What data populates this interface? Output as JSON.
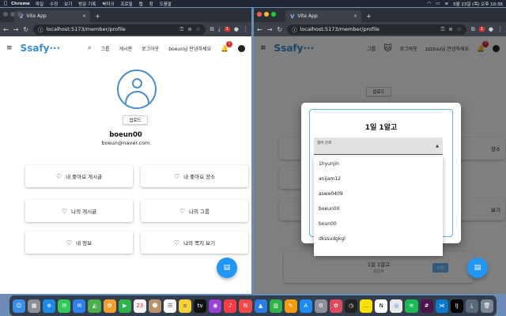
{
  "menubar": {
    "apple": "",
    "app": "Chrome",
    "items": [
      "파일",
      "수정",
      "보기",
      "방문 기록",
      "북마크",
      "프로필",
      "탭",
      "창",
      "도움말"
    ],
    "status": {
      "datetime": "5월 23일 (목) 오후 10:36"
    }
  },
  "left_window": {
    "tab_title": "Vite App",
    "url": "localhost:5173/member/profile",
    "nav": {
      "logo": "Ssafy···",
      "links": [
        "그룹",
        "게시판",
        "로그아웃"
      ],
      "greeting": "boeun님 안녕하세요",
      "badge": "1"
    },
    "profile": {
      "upload_label": "업로드",
      "username": "boeun00",
      "email": "boeun@naver.com"
    },
    "cards": [
      {
        "label": "내 좋아요 게시글",
        "icon": "heart-icon"
      },
      {
        "label": "내 좋아요 장소",
        "icon": "heart-icon"
      },
      {
        "label": "나의 게시글",
        "icon": "heart-icon"
      },
      {
        "label": "나의 그룹",
        "icon": "heart-icon"
      },
      {
        "label": "내 정보",
        "icon": "heart-icon"
      },
      {
        "label": "나의 쪽지 보기",
        "icon": "heart-icon"
      }
    ]
  },
  "right_window": {
    "tab_title": "Vite App",
    "url": "localhost:5173/member/profile",
    "nav": {
      "logo": "Ssafy···",
      "links": [
        "그룹",
        "로그아웃"
      ],
      "greeting": "zzzzuu님 안녕하세요",
      "badge": "1"
    },
    "upload_label": "업로드",
    "modal": {
      "title": "1일 1알고",
      "select_label": "멤버 검색",
      "options": [
        "1hyunjin",
        "anijam12",
        "aswe0409",
        "boeun00",
        "boun00",
        "dkssudgkgl"
      ]
    },
    "background": {
      "card_text": "1일 1알고",
      "card_sub": "관리자",
      "button": "수정",
      "side_labels": [
        "장소",
        "보기"
      ]
    }
  },
  "colors": {
    "brand": "#3d8bd0",
    "fab": "#2196f3",
    "badge": "#d32f2f"
  }
}
